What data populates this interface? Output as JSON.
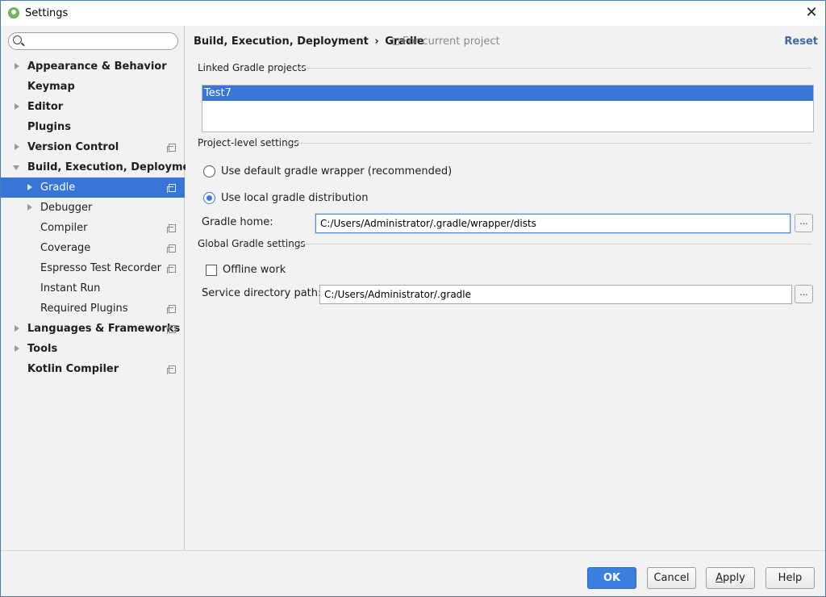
{
  "window": {
    "title": "Settings",
    "close_glyph": "✕"
  },
  "sidebar": {
    "search": {
      "value": "",
      "placeholder": ""
    },
    "items": [
      {
        "label": "Appearance & Behavior",
        "bold": true,
        "level": 0,
        "arrow": "right",
        "scope_icon": false,
        "selected": false
      },
      {
        "label": "Keymap",
        "bold": true,
        "level": 0,
        "arrow": "none",
        "scope_icon": false,
        "selected": false
      },
      {
        "label": "Editor",
        "bold": true,
        "level": 0,
        "arrow": "right",
        "scope_icon": false,
        "selected": false
      },
      {
        "label": "Plugins",
        "bold": true,
        "level": 0,
        "arrow": "none",
        "scope_icon": false,
        "selected": false
      },
      {
        "label": "Version Control",
        "bold": true,
        "level": 0,
        "arrow": "right",
        "scope_icon": true,
        "selected": false
      },
      {
        "label": "Build, Execution, Deployment",
        "bold": true,
        "level": 0,
        "arrow": "down",
        "scope_icon": false,
        "selected": false
      },
      {
        "label": "Gradle",
        "bold": false,
        "level": 1,
        "arrow": "right",
        "scope_icon": true,
        "selected": true
      },
      {
        "label": "Debugger",
        "bold": false,
        "level": 1,
        "arrow": "right",
        "scope_icon": false,
        "selected": false
      },
      {
        "label": "Compiler",
        "bold": false,
        "level": 1,
        "arrow": "none",
        "scope_icon": true,
        "selected": false
      },
      {
        "label": "Coverage",
        "bold": false,
        "level": 1,
        "arrow": "none",
        "scope_icon": true,
        "selected": false
      },
      {
        "label": "Espresso Test Recorder",
        "bold": false,
        "level": 1,
        "arrow": "none",
        "scope_icon": true,
        "selected": false
      },
      {
        "label": "Instant Run",
        "bold": false,
        "level": 1,
        "arrow": "none",
        "scope_icon": false,
        "selected": false
      },
      {
        "label": "Required Plugins",
        "bold": false,
        "level": 1,
        "arrow": "none",
        "scope_icon": true,
        "selected": false
      },
      {
        "label": "Languages & Frameworks",
        "bold": true,
        "level": 0,
        "arrow": "right",
        "scope_icon": true,
        "selected": false
      },
      {
        "label": "Tools",
        "bold": true,
        "level": 0,
        "arrow": "right",
        "scope_icon": false,
        "selected": false
      },
      {
        "label": "Kotlin Compiler",
        "bold": true,
        "level": 0,
        "arrow": "none",
        "scope_icon": true,
        "selected": false
      }
    ]
  },
  "content": {
    "breadcrumb": {
      "parent": "Build, Execution, Deployment",
      "separator": "›",
      "current": "Gradle"
    },
    "scope_label": "For current project",
    "reset_label": "Reset",
    "linked_projects": {
      "title": "Linked Gradle projects",
      "items": [
        "Test7"
      ]
    },
    "project_settings": {
      "title": "Project-level settings",
      "option_default": "Use default gradle wrapper (recommended)",
      "option_local": "Use local gradle distribution",
      "selected_option": "local",
      "gradle_home_label": "Gradle home:",
      "gradle_home_value": "C:/Users/Administrator/.gradle/wrapper/dists",
      "browse_label": "..."
    },
    "global_settings": {
      "title": "Global Gradle settings",
      "offline_label": "Offline work",
      "offline_checked": false,
      "service_dir_label": "Service directory path:",
      "service_dir_value": "C:/Users/Administrator/.gradle",
      "browse_label": "..."
    }
  },
  "footer": {
    "ok": "OK",
    "cancel": "Cancel",
    "apply_mnemonic": "A",
    "apply_rest": "pply",
    "help": "Help"
  },
  "colors": {
    "selection": "#3875d7",
    "primary_button": "#3d7fe0",
    "link": "#3d67a8"
  }
}
